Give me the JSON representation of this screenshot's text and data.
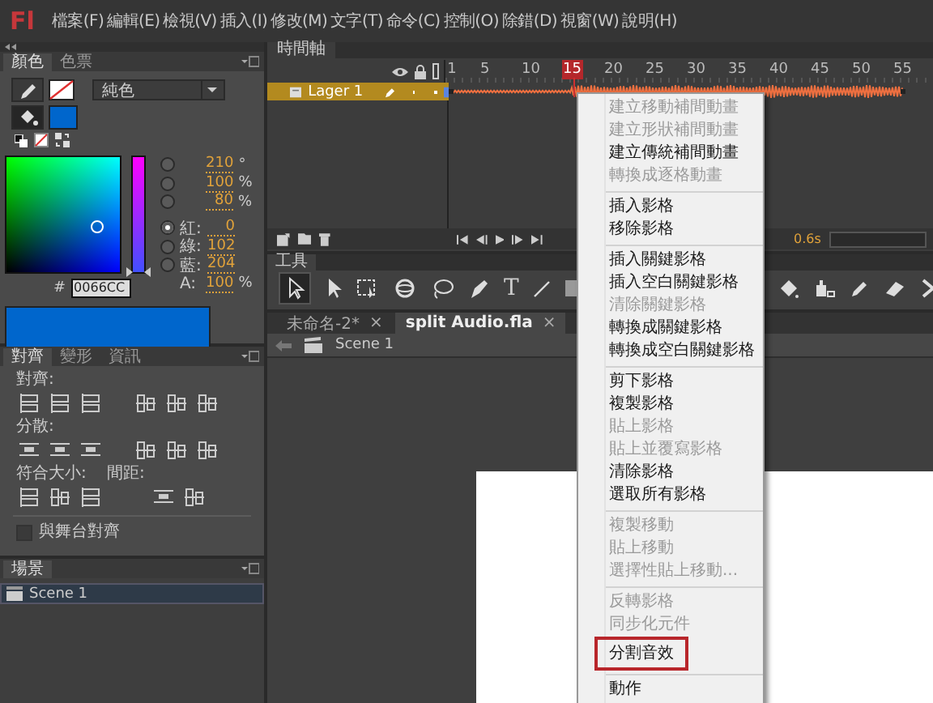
{
  "menu_bar": {
    "logo": "Fl",
    "items": [
      "檔案(F)",
      "編輯(E)",
      "檢視(V)",
      "插入(I)",
      "修改(M)",
      "文字(T)",
      "命令(C)",
      "控制(O)",
      "除錯(D)",
      "視窗(W)",
      "說明(H)"
    ]
  },
  "color_panel": {
    "tabs": [
      {
        "label": "顏色",
        "selected": true
      },
      {
        "label": "色票",
        "selected": false
      }
    ],
    "fill_type": "純色",
    "slider": {
      "level": 0
    },
    "channels": [
      {
        "kind": "radio",
        "value": "210",
        "unit": "°",
        "selected": false
      },
      {
        "kind": "radio",
        "value": "100",
        "unit": "%",
        "selected": false
      },
      {
        "kind": "radio",
        "value": "80",
        "unit": "%",
        "selected": false
      },
      {
        "kind": "radio",
        "label": "紅:",
        "value": "0",
        "selected": true
      },
      {
        "kind": "radio",
        "label": "綠:",
        "value": "102",
        "selected": false
      },
      {
        "kind": "radio",
        "label": "藍:",
        "value": "204",
        "selected": false
      },
      {
        "kind": "plain",
        "label": "A:",
        "value": "100",
        "unit": "%"
      }
    ],
    "hex_label": "#",
    "hex": "0066CC"
  },
  "align_panel": {
    "tabs": [
      {
        "label": "對齊",
        "selected": true
      },
      {
        "label": "變形",
        "selected": false
      },
      {
        "label": "資訊",
        "selected": false
      }
    ],
    "sections": [
      {
        "label": "對齊:"
      },
      {
        "label": "分散:"
      },
      {
        "label": "符合大小:"
      },
      {
        "label": "間距:"
      }
    ],
    "stage_align": {
      "label": "與舞台對齊",
      "checked": false
    }
  },
  "scene_panel": {
    "tab": "場景",
    "scenes": [
      {
        "name": "Scene 1",
        "selected": true
      }
    ]
  },
  "timeline": {
    "tab": "時間軸",
    "frame_numbers": [
      {
        "label": "1",
        "selected": false
      },
      {
        "label": "5",
        "selected": false
      },
      {
        "label": "10",
        "selected": false
      },
      {
        "label": "15",
        "selected": true
      },
      {
        "label": "20",
        "selected": false
      },
      {
        "label": "25",
        "selected": false
      },
      {
        "label": "30",
        "selected": false
      },
      {
        "label": "35",
        "selected": false
      },
      {
        "label": "40",
        "selected": false
      },
      {
        "label": "45",
        "selected": false
      },
      {
        "label": "50",
        "selected": false
      },
      {
        "label": "55",
        "selected": false
      }
    ],
    "layers": [
      {
        "name": "Lager 1",
        "selected": true
      }
    ],
    "time": "0.6s"
  },
  "tools": {
    "title": "工具",
    "text_tool_glyph": "T"
  },
  "document_tabs": [
    {
      "label": "未命名-2*",
      "selected": false
    },
    {
      "label": "split Audio.fla",
      "selected": true
    }
  ],
  "close_glyph": "×",
  "scene_bar": {
    "scene": "Scene 1"
  },
  "context_menu": {
    "groups": [
      {
        "items": [
          {
            "label": "建立移動補間動畫",
            "disabled": true,
            "outlined": false
          },
          {
            "label": "建立形狀補間動畫",
            "disabled": true,
            "outlined": false
          },
          {
            "label": "建立傳統補間動畫",
            "disabled": false,
            "outlined": false
          },
          {
            "label": "轉換成逐格動畫",
            "disabled": true,
            "outlined": false
          }
        ]
      },
      {
        "items": [
          {
            "label": "插入影格",
            "disabled": false,
            "outlined": false
          },
          {
            "label": "移除影格",
            "disabled": false,
            "outlined": false
          }
        ]
      },
      {
        "items": [
          {
            "label": "插入關鍵影格",
            "disabled": false,
            "outlined": false
          },
          {
            "label": "插入空白關鍵影格",
            "disabled": false,
            "outlined": false
          },
          {
            "label": "清除關鍵影格",
            "disabled": true,
            "outlined": false
          },
          {
            "label": "轉換成關鍵影格",
            "disabled": false,
            "outlined": false
          },
          {
            "label": "轉換成空白關鍵影格",
            "disabled": false,
            "outlined": false
          }
        ]
      },
      {
        "items": [
          {
            "label": "剪下影格",
            "disabled": false,
            "outlined": false
          },
          {
            "label": "複製影格",
            "disabled": false,
            "outlined": false
          },
          {
            "label": "貼上影格",
            "disabled": true,
            "outlined": false
          },
          {
            "label": "貼上並覆寫影格",
            "disabled": true,
            "outlined": false
          },
          {
            "label": "清除影格",
            "disabled": false,
            "outlined": false
          },
          {
            "label": "選取所有影格",
            "disabled": false,
            "outlined": false
          }
        ]
      },
      {
        "items": [
          {
            "label": "複製移動",
            "disabled": true,
            "outlined": false
          },
          {
            "label": "貼上移動",
            "disabled": true,
            "outlined": false
          },
          {
            "label": "選擇性貼上移動...",
            "disabled": true,
            "outlined": false
          }
        ]
      },
      {
        "items": [
          {
            "label": "反轉影格",
            "disabled": true,
            "outlined": false
          },
          {
            "label": "同步化元件",
            "disabled": true,
            "outlined": false
          },
          {
            "label": "分割音效",
            "disabled": false,
            "outlined": true
          }
        ]
      },
      {
        "items": [
          {
            "label": "動作",
            "disabled": false,
            "outlined": false
          }
        ]
      }
    ]
  }
}
